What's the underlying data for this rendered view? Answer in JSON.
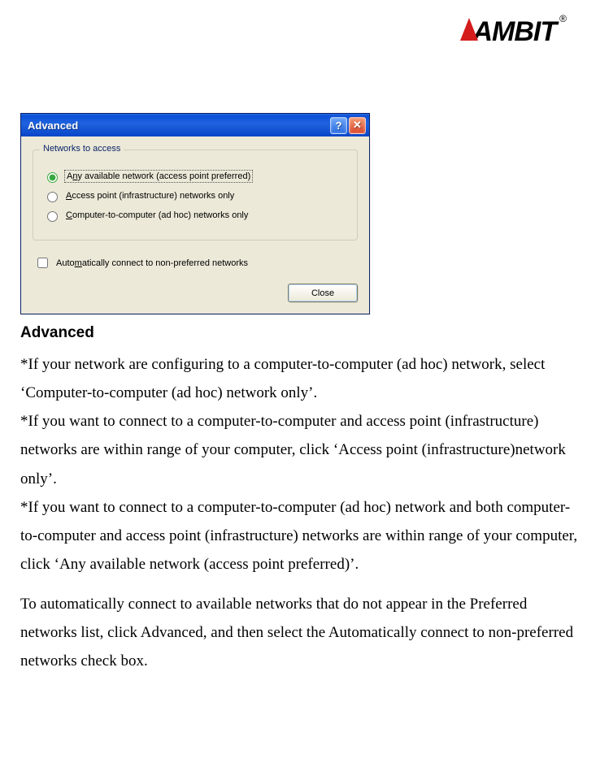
{
  "brand": {
    "name": "AMBIT",
    "registered": "®"
  },
  "dialog": {
    "title": "Advanced",
    "help_symbol": "?",
    "close_symbol": "✕",
    "group_legend": "Networks to access",
    "radios": [
      {
        "label_html": "A<u>n</u>y available network (access point preferred)",
        "checked": true
      },
      {
        "label_html": "<u>A</u>ccess point (infrastructure) networks only",
        "checked": false
      },
      {
        "label_html": "<u>C</u>omputer-to-computer (ad hoc) networks only",
        "checked": false
      }
    ],
    "checkbox_label_html": "Auto<u>m</u>atically connect to non-preferred networks",
    "checkbox_checked": false,
    "close_button": "Close"
  },
  "doc": {
    "heading": "Advanced",
    "p1": "*If your network are configuring to a computer-to-computer (ad hoc) network, select ‘Computer-to-computer (ad hoc) network only’.",
    "p2": "*If you want to connect to a computer-to-computer and access point (infrastructure) networks are within range of your computer, click ‘Access point (infrastructure)network only’.",
    "p3": "*If you want to connect to a computer-to-computer (ad hoc) network and both computer-to-computer and access point (infrastructure) networks are within range of your computer, click ‘Any available network (access point preferred)’.",
    "p4": "To automatically connect to available networks that do not appear in the Preferred networks list, click Advanced, and then select the Automatically connect to non-preferred networks check box."
  }
}
